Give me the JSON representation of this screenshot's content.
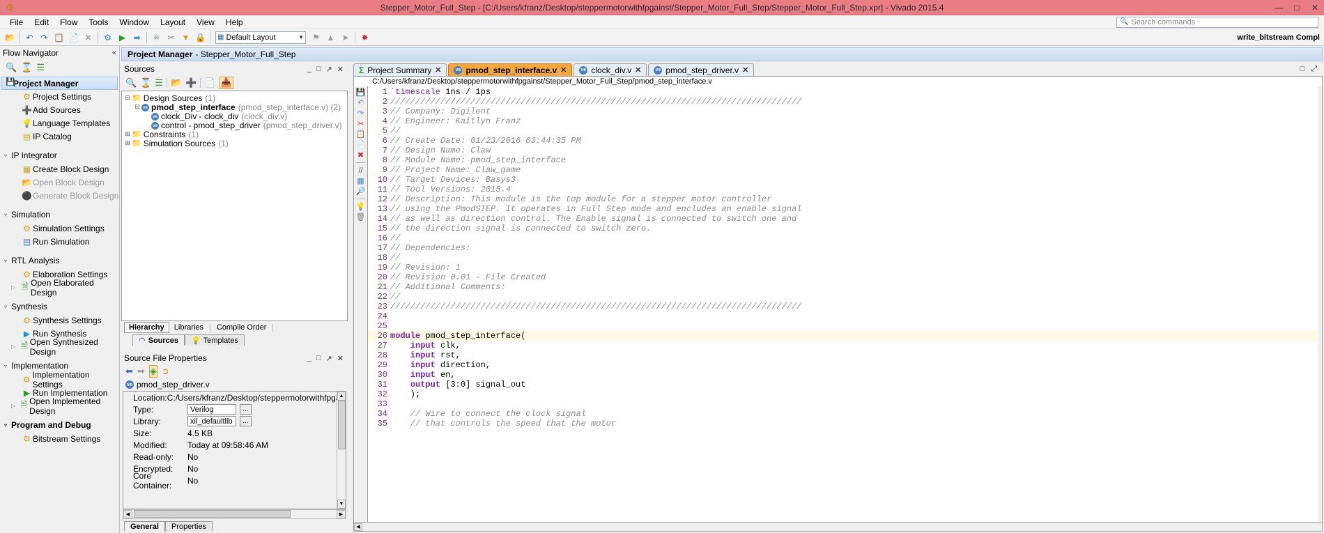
{
  "titlebar": {
    "title": "Stepper_Motor_Full_Step - [C:/Users/kfranz/Desktop/steppermotorwithfpgainst/Stepper_Motor_Full_Step/Stepper_Motor_Full_Step.xpr] - Vivado 2015.4",
    "app_icon": "vivado-logo",
    "minimize": "—",
    "maximize": "□",
    "close": "✕",
    "bg_color": "#ea7c85"
  },
  "menubar": {
    "items": [
      "File",
      "Edit",
      "Flow",
      "Tools",
      "Window",
      "Layout",
      "View",
      "Help"
    ],
    "search_placeholder": "Search commands"
  },
  "toolbar": {
    "layout_label": "Default Layout",
    "status_right": "write_bitstream Compl"
  },
  "flow_navigator": {
    "title": "Flow Navigator",
    "collapse_icon": "chevron-double-left-icon",
    "tools": [
      "search-icon",
      "collapse-all-icon",
      "expand-all-icon"
    ],
    "sections": [
      {
        "label": "Project Manager",
        "selected": true,
        "items": [
          {
            "label": "Project Settings",
            "icon": "gear-icon",
            "dim": false
          },
          {
            "label": "Add Sources",
            "icon": "add-sources-icon",
            "dim": false
          },
          {
            "label": "Language Templates",
            "icon": "lightbulb-icon",
            "dim": false
          },
          {
            "label": "IP Catalog",
            "icon": "ip-catalog-icon",
            "dim": false
          }
        ]
      },
      {
        "label": "IP Integrator",
        "selected": false,
        "items": [
          {
            "label": "Create Block Design",
            "icon": "block-design-icon",
            "dim": false
          },
          {
            "label": "Open Block Design",
            "icon": "open-block-icon",
            "dim": true
          },
          {
            "label": "Generate Block Design",
            "icon": "generate-block-icon",
            "dim": true
          }
        ]
      },
      {
        "label": "Simulation",
        "selected": false,
        "items": [
          {
            "label": "Simulation Settings",
            "icon": "gear-icon",
            "dim": false
          },
          {
            "label": "Run Simulation",
            "icon": "waveform-icon",
            "dim": false
          }
        ]
      },
      {
        "label": "RTL Analysis",
        "selected": false,
        "items": [
          {
            "label": "Elaboration Settings",
            "icon": "gear-icon",
            "dim": false
          },
          {
            "label": "Open Elaborated Design",
            "icon": "open-design-icon",
            "dim": false,
            "expandable": true
          }
        ]
      },
      {
        "label": "Synthesis",
        "selected": false,
        "items": [
          {
            "label": "Synthesis Settings",
            "icon": "gear-icon",
            "dim": false
          },
          {
            "label": "Run Synthesis",
            "icon": "run-icon",
            "dim": false
          },
          {
            "label": "Open Synthesized Design",
            "icon": "open-design-icon",
            "dim": false,
            "expandable": true
          }
        ]
      },
      {
        "label": "Implementation",
        "selected": false,
        "items": [
          {
            "label": "Implementation Settings",
            "icon": "gear-icon",
            "dim": false
          },
          {
            "label": "Run Implementation",
            "icon": "play-icon",
            "dim": false
          },
          {
            "label": "Open Implemented Design",
            "icon": "open-design-icon",
            "dim": false,
            "expandable": true
          }
        ]
      },
      {
        "label": "Program and Debug",
        "selected": false,
        "bold": true,
        "items": [
          {
            "label": "Bitstream Settings",
            "icon": "gear-icon",
            "dim": false
          }
        ]
      }
    ]
  },
  "project_header": {
    "bold": "Project Manager",
    "rest": "- Stepper_Motor_Full_Step"
  },
  "sources_panel": {
    "title": "Sources",
    "window_buttons": [
      "_",
      "□",
      "✕"
    ],
    "tree": [
      {
        "depth": 0,
        "toggle": "-",
        "icon": "folder-icon",
        "label": "Design Sources",
        "suffix": "(1)",
        "bold": false
      },
      {
        "depth": 1,
        "toggle": "-",
        "icon": "verilog-icon",
        "label": "pmod_step_interface",
        "suffix": "(pmod_step_interface.v) (2)",
        "bold": true
      },
      {
        "depth": 2,
        "toggle": "",
        "icon": "verilog-icon",
        "label": "clock_Div - clock_div",
        "suffix": "(clock_div.v)",
        "bold": false
      },
      {
        "depth": 2,
        "toggle": "",
        "icon": "verilog-icon",
        "label": "control - pmod_step_driver",
        "suffix": "(pmod_step_driver.v)",
        "bold": false
      },
      {
        "depth": 0,
        "toggle": "+",
        "icon": "folder-icon",
        "label": "Constraints",
        "suffix": "(1)",
        "bold": false
      },
      {
        "depth": 0,
        "toggle": "+",
        "icon": "folder-icon",
        "label": "Simulation Sources",
        "suffix": "(1)",
        "bold": false
      }
    ],
    "sub_tabs": [
      {
        "label": "Hierarchy",
        "active": true
      },
      {
        "label": "Libraries",
        "active": false
      },
      {
        "label": "Compile Order",
        "active": false
      }
    ],
    "bottom_tabs": [
      {
        "label": "Sources",
        "active": true,
        "icon": "hierarchy-icon"
      },
      {
        "label": "Templates",
        "active": false,
        "icon": "lightbulb-icon"
      }
    ]
  },
  "source_file_properties": {
    "title": "Source File Properties",
    "window_buttons": [
      "_",
      "□",
      "✕"
    ],
    "file_name": "pmod_step_driver.v",
    "rows": [
      {
        "label": "Location:",
        "value": "C:/Users/kfranz/Desktop/steppermotorwithfpgainst/Step",
        "type": "text"
      },
      {
        "label": "Type:",
        "value": "Verilog",
        "type": "field"
      },
      {
        "label": "Library:",
        "value": "xil_defaultlib",
        "type": "field"
      },
      {
        "label": "Size:",
        "value": "4.5 KB",
        "type": "text"
      },
      {
        "label": "Modified:",
        "value": "Today at 09:58:46 AM",
        "type": "text"
      },
      {
        "label": "Read-only:",
        "value": "No",
        "type": "text"
      },
      {
        "label": "Encrypted:",
        "value": "No",
        "type": "text"
      },
      {
        "label": "Core Container:",
        "value": "No",
        "type": "text"
      }
    ],
    "bottom_tabs": [
      {
        "label": "General",
        "active": true
      },
      {
        "label": "Properties",
        "active": false
      }
    ]
  },
  "editor": {
    "window_buttons": [
      "□",
      "⤢"
    ],
    "tabs": [
      {
        "label": "Project Summary",
        "active": false,
        "icon": "sigma-icon"
      },
      {
        "label": "pmod_step_interface.v",
        "active": true,
        "icon": "verilog-icon"
      },
      {
        "label": "clock_div.v",
        "active": false,
        "icon": "verilog-icon"
      },
      {
        "label": "pmod_step_driver.v",
        "active": false,
        "icon": "verilog-icon"
      }
    ],
    "path": "C:/Users/kfranz/Desktop/steppermotorwithfpgainst/Stepper_Motor_Full_Step/pmod_step_interface.v",
    "gutter_icons": [
      "save-icon",
      "undo-icon",
      "redo-icon",
      "cut-icon",
      "copy-icon",
      "paste-icon",
      "delete-icon",
      "comment-icon",
      "indent-icon",
      "find-icon",
      "lightbulb-icon",
      "trash-icon"
    ],
    "lines": [
      {
        "n": 1,
        "highlight": false,
        "spans": [
          {
            "t": "`timescale",
            "c": "cdir"
          },
          {
            "t": " 1ns / 1ps",
            "c": "cplain"
          }
        ]
      },
      {
        "n": 2,
        "highlight": false,
        "spans": [
          {
            "t": "//////////////////////////////////////////////////////////////////////////////////",
            "c": "cm"
          }
        ]
      },
      {
        "n": 3,
        "highlight": false,
        "spans": [
          {
            "t": "// Company: Digilent",
            "c": "cm"
          }
        ]
      },
      {
        "n": 4,
        "highlight": false,
        "spans": [
          {
            "t": "// Engineer: Kaitlyn Franz",
            "c": "cm"
          }
        ]
      },
      {
        "n": 5,
        "highlight": false,
        "spans": [
          {
            "t": "//",
            "c": "cm"
          }
        ]
      },
      {
        "n": 6,
        "highlight": false,
        "spans": [
          {
            "t": "// Create Date: 01/23/2016 03:44:35 PM",
            "c": "cm"
          }
        ]
      },
      {
        "n": 7,
        "highlight": false,
        "spans": [
          {
            "t": "// Design Name: Claw",
            "c": "cm"
          }
        ]
      },
      {
        "n": 8,
        "highlight": false,
        "spans": [
          {
            "t": "// Module Name: pmod_step_interface",
            "c": "cm"
          }
        ]
      },
      {
        "n": 9,
        "highlight": false,
        "spans": [
          {
            "t": "// Project Name: Claw_game",
            "c": "cm"
          }
        ]
      },
      {
        "n": 10,
        "highlight": false,
        "spans": [
          {
            "t": "// Target Devices: Basys3",
            "c": "cm"
          }
        ]
      },
      {
        "n": 11,
        "highlight": false,
        "spans": [
          {
            "t": "// Tool Versions: 2015.4",
            "c": "cm"
          }
        ]
      },
      {
        "n": 12,
        "highlight": false,
        "spans": [
          {
            "t": "// Description: This module is the top module for a stepper motor controller",
            "c": "cm"
          }
        ]
      },
      {
        "n": 13,
        "highlight": false,
        "spans": [
          {
            "t": "// using the PmodSTEP. It operates in Full Step mode and encludes an enable signal",
            "c": "cm"
          }
        ]
      },
      {
        "n": 14,
        "highlight": false,
        "spans": [
          {
            "t": "// as well as direction control. The Enable signal is connected to switch one and",
            "c": "cm"
          }
        ]
      },
      {
        "n": 15,
        "highlight": false,
        "spans": [
          {
            "t": "// the direction signal is connected to switch zero.",
            "c": "cm"
          }
        ]
      },
      {
        "n": 16,
        "highlight": false,
        "spans": [
          {
            "t": "//",
            "c": "cm"
          }
        ]
      },
      {
        "n": 17,
        "highlight": false,
        "spans": [
          {
            "t": "// Dependencies:",
            "c": "cm"
          }
        ]
      },
      {
        "n": 18,
        "highlight": false,
        "spans": [
          {
            "t": "//",
            "c": "cm"
          }
        ]
      },
      {
        "n": 19,
        "highlight": false,
        "spans": [
          {
            "t": "// Revision: 1",
            "c": "cm"
          }
        ]
      },
      {
        "n": 20,
        "highlight": false,
        "spans": [
          {
            "t": "// Revision 0.01 - File Created",
            "c": "cm"
          }
        ]
      },
      {
        "n": 21,
        "highlight": false,
        "spans": [
          {
            "t": "// Additional Comments:",
            "c": "cm"
          }
        ]
      },
      {
        "n": 22,
        "highlight": false,
        "spans": [
          {
            "t": "//",
            "c": "cm"
          }
        ]
      },
      {
        "n": 23,
        "highlight": false,
        "spans": [
          {
            "t": "//////////////////////////////////////////////////////////////////////////////////",
            "c": "cm"
          }
        ]
      },
      {
        "n": 24,
        "highlight": false,
        "spans": [
          {
            "t": "",
            "c": "cplain"
          }
        ]
      },
      {
        "n": 25,
        "highlight": false,
        "spans": [
          {
            "t": "",
            "c": "cplain"
          }
        ]
      },
      {
        "n": 26,
        "highlight": true,
        "spans": [
          {
            "t": "module",
            "c": "ckw"
          },
          {
            "t": " pmod_step_interface(",
            "c": "cplain"
          }
        ]
      },
      {
        "n": 27,
        "highlight": false,
        "spans": [
          {
            "t": "    ",
            "c": "cplain"
          },
          {
            "t": "input",
            "c": "ckw"
          },
          {
            "t": " clk,",
            "c": "cplain"
          }
        ]
      },
      {
        "n": 28,
        "highlight": false,
        "spans": [
          {
            "t": "    ",
            "c": "cplain"
          },
          {
            "t": "input",
            "c": "ckw"
          },
          {
            "t": " rst,",
            "c": "cplain"
          }
        ]
      },
      {
        "n": 29,
        "highlight": false,
        "spans": [
          {
            "t": "    ",
            "c": "cplain"
          },
          {
            "t": "input",
            "c": "ckw"
          },
          {
            "t": " direction,",
            "c": "cplain"
          }
        ]
      },
      {
        "n": 30,
        "highlight": false,
        "spans": [
          {
            "t": "    ",
            "c": "cplain"
          },
          {
            "t": "input",
            "c": "ckw"
          },
          {
            "t": " en,",
            "c": "cplain"
          }
        ]
      },
      {
        "n": 31,
        "highlight": false,
        "spans": [
          {
            "t": "    ",
            "c": "cplain"
          },
          {
            "t": "output",
            "c": "ckw"
          },
          {
            "t": " [3:0] signal_out",
            "c": "cplain"
          }
        ]
      },
      {
        "n": 32,
        "highlight": false,
        "spans": [
          {
            "t": "    );",
            "c": "cplain"
          }
        ]
      },
      {
        "n": 33,
        "highlight": false,
        "spans": [
          {
            "t": "",
            "c": "cplain"
          }
        ]
      },
      {
        "n": 34,
        "highlight": false,
        "spans": [
          {
            "t": "    // Wire to connect the clock signal",
            "c": "cm"
          }
        ]
      },
      {
        "n": 35,
        "highlight": false,
        "spans": [
          {
            "t": "    // that controls the speed that the motor",
            "c": "cm"
          }
        ]
      }
    ]
  }
}
